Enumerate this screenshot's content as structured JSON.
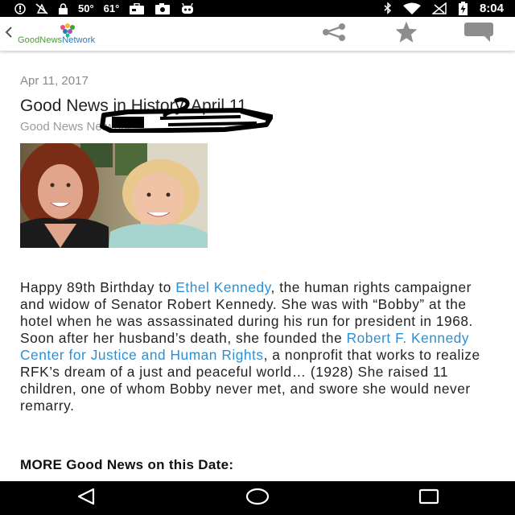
{
  "status_bar": {
    "temp1": "50°",
    "temp2": "61°",
    "time": "8:04",
    "icons": [
      "android-debug-icon",
      "no-location-icon",
      "lock-icon",
      "briefcase-icon",
      "photo-icon",
      "robot-icon",
      "bluetooth-icon",
      "wifi-icon",
      "no-signal-icon",
      "battery-charging-icon"
    ]
  },
  "app_bar": {
    "logo_good": "GoodNews",
    "logo_network": "Network",
    "icons": [
      "back-chevron-icon",
      "share-icon",
      "star-icon",
      "comment-icon"
    ]
  },
  "article": {
    "date": "Apr 11, 2017",
    "title": "Good News in History, April 11",
    "byline": "Good News Network",
    "p_segments": {
      "s1": "Happy 89th Birthday to ",
      "link1": "Ethel Kennedy",
      "s2": ", the human rights campaigner and widow of Senator Robert Kennedy. She was with “Bobby” at the hotel when he was assassinated during his run for president in 1968. Soon after her husband’s death, she founded the ",
      "link2": "Robert F. Kennedy Center for Justice and Human Rights",
      "s3": ", a nonprofit that works to realize RFK’s dream of a just and peaceful world… (1928) She raised 11 children, one of whom Bobby never met, and swore she would never remarry."
    },
    "more_heading": "MORE Good News on this Date:"
  },
  "colors": {
    "link": "#2b8fd6",
    "status_bar": "#000000",
    "nav_bar": "#000000"
  },
  "nav_bar": {
    "icons": [
      "back-triangle-icon",
      "home-circle-icon",
      "recents-square-icon"
    ]
  }
}
